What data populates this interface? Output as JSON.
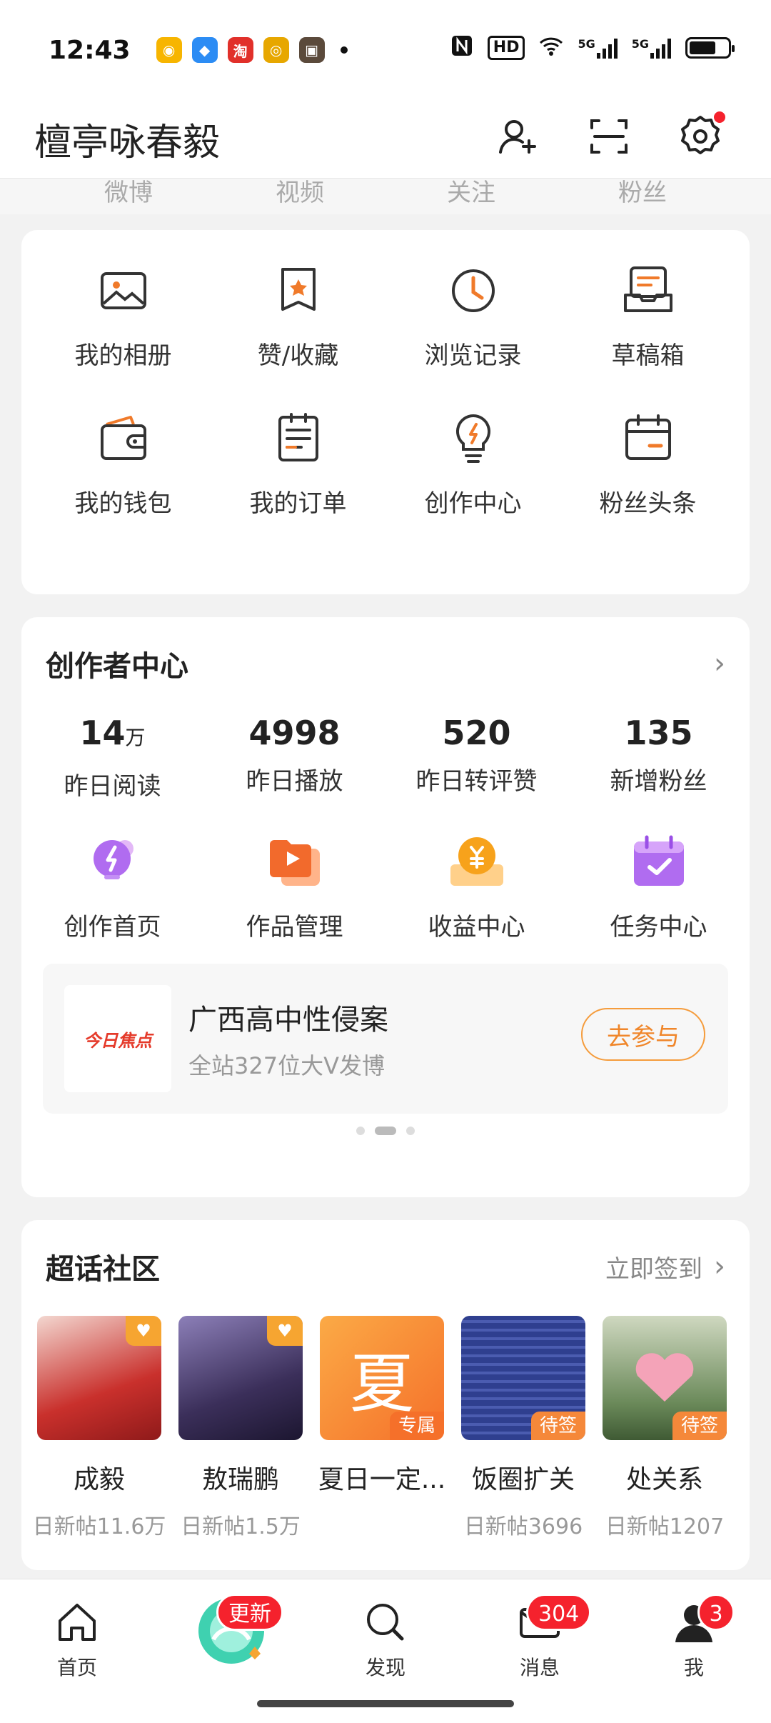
{
  "status_bar": {
    "time": "12:43",
    "notification_icons": [
      "weibo-icon",
      "blue-app-icon",
      "taobao-icon",
      "gold-app-icon",
      "photo-app-icon"
    ],
    "network": "5G",
    "hd": "HD"
  },
  "header": {
    "title": "檀亭咏春毅",
    "actions": [
      "add-friend-icon",
      "scan-icon",
      "settings-icon"
    ]
  },
  "stats_strip": [
    "微博",
    "视频",
    "关注",
    "粉丝"
  ],
  "menu": [
    {
      "label": "我的相册",
      "icon": "album-icon"
    },
    {
      "label": "赞/收藏",
      "icon": "favorites-icon"
    },
    {
      "label": "浏览记录",
      "icon": "history-icon"
    },
    {
      "label": "草稿箱",
      "icon": "drafts-icon"
    },
    {
      "label": "我的钱包",
      "icon": "wallet-icon"
    },
    {
      "label": "我的订单",
      "icon": "orders-icon"
    },
    {
      "label": "创作中心",
      "icon": "bulb-icon"
    },
    {
      "label": "粉丝头条",
      "icon": "calendar-icon"
    }
  ],
  "creator": {
    "title": "创作者中心",
    "metrics": [
      {
        "value": "14",
        "unit": "万",
        "label": "昨日阅读"
      },
      {
        "value": "4998",
        "unit": "",
        "label": "昨日播放"
      },
      {
        "value": "520",
        "unit": "",
        "label": "昨日转评赞"
      },
      {
        "value": "135",
        "unit": "",
        "label": "新增粉丝"
      }
    ],
    "tools": [
      {
        "label": "创作首页",
        "icon": "create-home-icon"
      },
      {
        "label": "作品管理",
        "icon": "works-icon"
      },
      {
        "label": "收益中心",
        "icon": "income-icon"
      },
      {
        "label": "任务中心",
        "icon": "tasks-icon"
      }
    ],
    "banner": {
      "logo": "今日焦点",
      "title": "广西高中性侵案",
      "subtitle": "全站327位大V发博",
      "button": "去参与"
    }
  },
  "super_topics": {
    "title": "超话社区",
    "action": "立即签到",
    "items": [
      {
        "name": "成毅",
        "count": "日新帖11.6万",
        "tag": "",
        "color": "#c9302c"
      },
      {
        "name": "敖瑞鹏",
        "count": "日新帖1.5万",
        "tag": "",
        "color": "#3b2f5a"
      },
      {
        "name": "夏日一定...",
        "count": "",
        "tag": "专属",
        "color": "#f7862a",
        "glyph": "夏"
      },
      {
        "name": "饭圈扩关",
        "count": "日新帖3696",
        "tag": "待签",
        "color": "#2f3f8f"
      },
      {
        "name": "处关系",
        "count": "日新帖1207",
        "tag": "待签",
        "color": "#6b8a5a"
      }
    ]
  },
  "tabbar": {
    "items": [
      {
        "label": "首页",
        "icon": "home-icon"
      },
      {
        "label": "",
        "icon": "center-logo-icon",
        "badge": "更新"
      },
      {
        "label": "发现",
        "icon": "discover-icon"
      },
      {
        "label": "消息",
        "icon": "message-icon",
        "badge": "304"
      },
      {
        "label": "我",
        "icon": "profile-icon",
        "badge": "3"
      }
    ]
  }
}
